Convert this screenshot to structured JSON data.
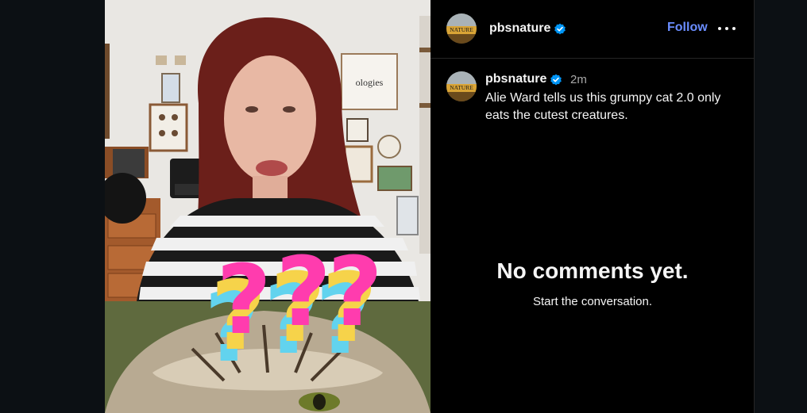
{
  "post": {
    "username": "pbsnature",
    "verified_icon": "verified-badge-icon",
    "follow_label": "Follow",
    "more_icon": "more-options-icon",
    "avatar_text": "NATURE"
  },
  "caption": {
    "username": "pbsnature",
    "time": "2m",
    "text": "Alie Ward tells us this grumpy cat 2.0 only eats the cutest creatures."
  },
  "comments": {
    "empty_title": "No comments yet.",
    "empty_subtitle": "Start the conversation."
  },
  "media": {
    "poster_word": "ologies",
    "overlay_glyphs": "???"
  },
  "colors": {
    "background": "#0c1014",
    "panel": "#000000",
    "divider": "#262626",
    "follow": "#6a8dff",
    "verified": "#0095f6",
    "muted_text": "#a8a8a8"
  }
}
